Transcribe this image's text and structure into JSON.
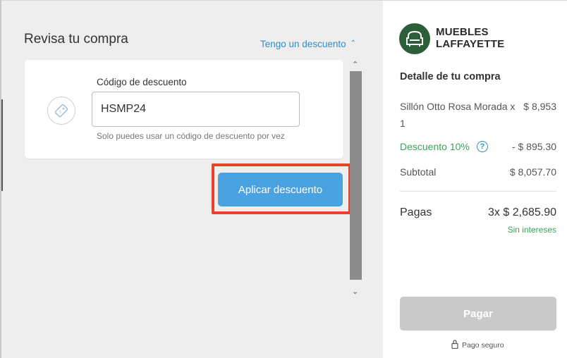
{
  "left": {
    "title": "Revisa tu compra",
    "discount_toggle": "Tengo un descuento",
    "discount_toggle_icon": "chevron-up-icon",
    "card": {
      "icon": "discount-tag-icon",
      "label": "Código de descuento",
      "code_value": "HSMP24",
      "hint": "Solo puedes usar un código de descuento por vez"
    },
    "apply_button": "Aplicar descuento"
  },
  "right": {
    "brand_line1": "MUEBLES",
    "brand_line2": "LAFFAYETTE",
    "detail_title": "Detalle de tu compra",
    "item_name": "Sillón Otto Rosa Morada x 1",
    "item_price": "$ 8,953",
    "discount_label": "Descuento 10%",
    "discount_value": "- $ 895.30",
    "subtotal_label": "Subtotal",
    "subtotal_value": "$ 8,057.70",
    "pay_label": "Pagas",
    "pay_value": "3x $ 2,685.90",
    "interest_note": "Sin intereses",
    "pay_button": "Pagar",
    "secure_note": "Pago seguro"
  },
  "colors": {
    "accent_blue": "#4aa3e0",
    "link_blue": "#2f8fc8",
    "green": "#3aa35a",
    "highlight_red": "#e8412c",
    "brand_green": "#2d5e3a"
  }
}
